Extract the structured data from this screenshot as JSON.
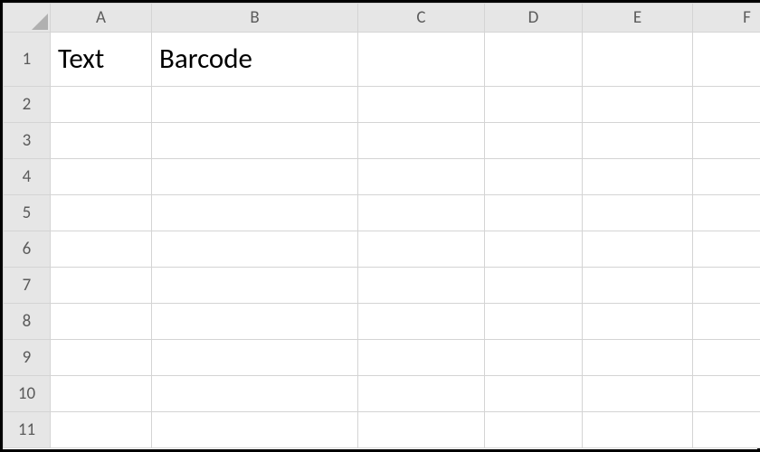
{
  "columns": [
    "A",
    "B",
    "C",
    "D",
    "E",
    "F"
  ],
  "rows": [
    "1",
    "2",
    "3",
    "4",
    "5",
    "6",
    "7",
    "8",
    "9",
    "10",
    "11"
  ],
  "cells": {
    "A1": "Text",
    "B1": "Barcode"
  },
  "icons": {
    "select_all": "select-all-triangle"
  },
  "colors": {
    "header_bg": "#e6e6e6",
    "gridline": "#d4d4d4",
    "header_border": "#bdbdbd",
    "header_text": "#5b5b5b",
    "cell_text": "#000000"
  }
}
